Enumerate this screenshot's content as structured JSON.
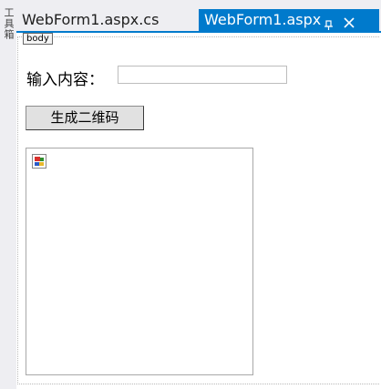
{
  "sidebar": {
    "toolbox_label": "工具箱"
  },
  "tabs": [
    {
      "label": "WebForm1.aspx.cs",
      "active": false
    },
    {
      "label": "WebForm1.aspx",
      "active": true
    }
  ],
  "editor": {
    "body_tag": "body",
    "input_label": "输入内容：",
    "input_value": "",
    "button_label": "生成二维码",
    "image_icon": "broken-image-icon"
  },
  "colors": {
    "accent": "#007acc",
    "tab_bar_bg": "#eeeef2"
  }
}
